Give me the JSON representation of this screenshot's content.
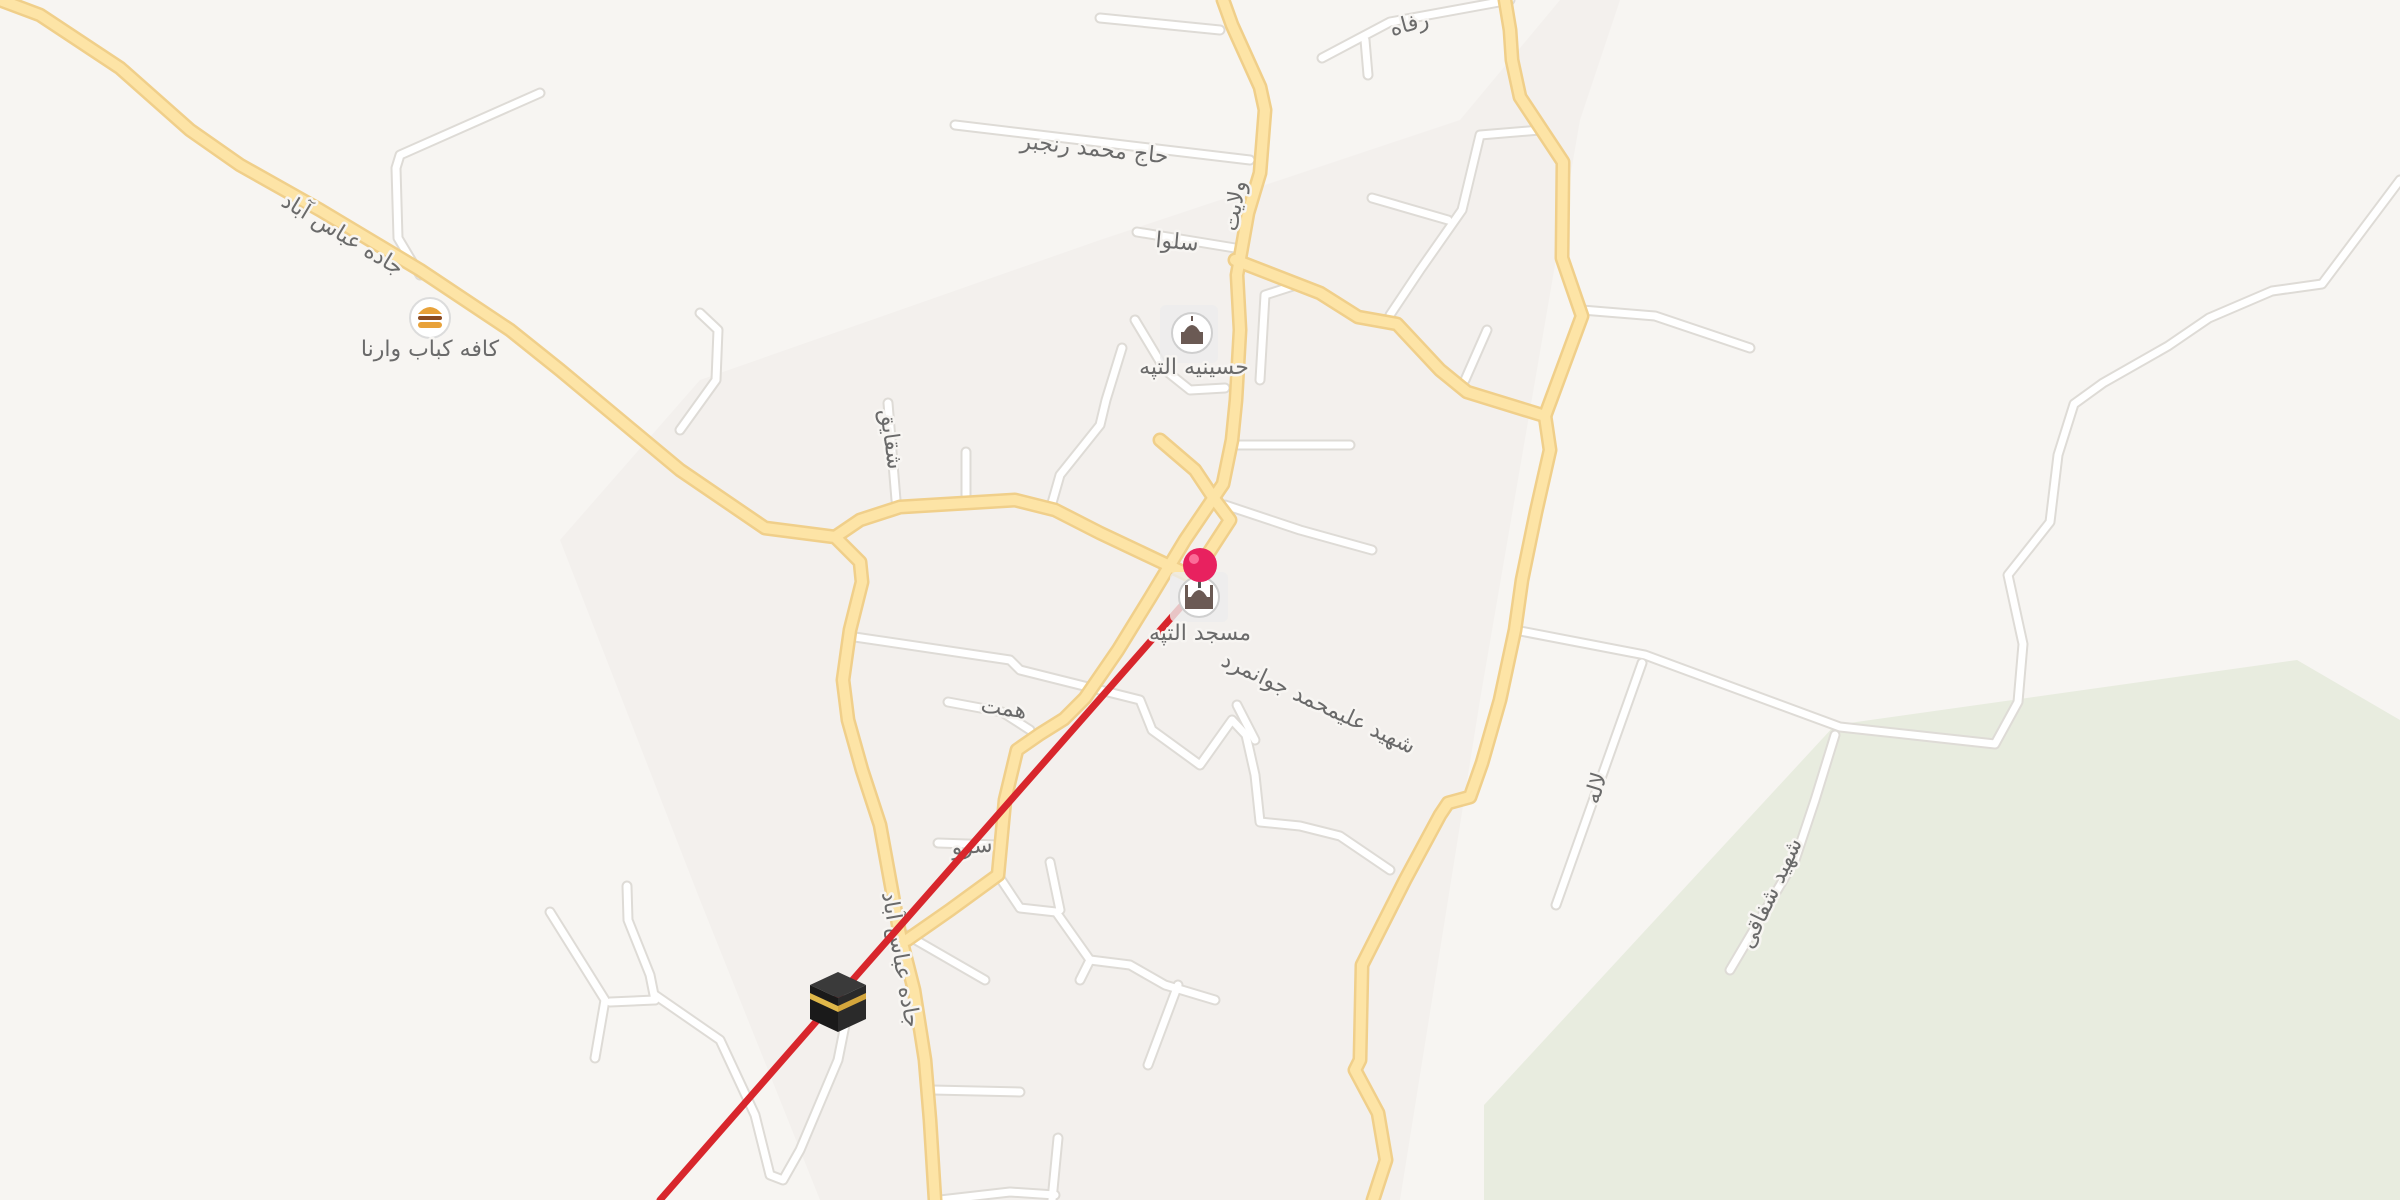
{
  "colors": {
    "land": "#f7f5f2",
    "park": "#e8ecdf",
    "main_road_fill": "#fde4a6",
    "main_road_casing": "#f0cf8a",
    "minor_road_fill": "#ffffff",
    "minor_road_casing": "#dedbd6",
    "route_line": "#d8262c",
    "pin": "#e8215f",
    "label": "#6a6a6a"
  },
  "roads": {
    "abbas_abad_upper": "جاده عباس آباد",
    "abbas_abad_lower": "جاده عباس آباد",
    "haj_mohammad": "حاج محمد رنجبر",
    "selva": "سلوا",
    "velayat": "ولایت",
    "refah": "رفاه",
    "shaghayegh": "شقایق",
    "hemmat": "همت",
    "sarv": "سرو",
    "shahid_javanmard": "شهید علیمحمد جوانمرد",
    "laleh": "لاله",
    "shahid_shafaghi": "شهید شفاقی"
  },
  "pois": {
    "cafe": {
      "label": "کافه کباب وارنا",
      "icon": "burger-icon"
    },
    "hosseinieh": {
      "label": "حسینیه التپه",
      "icon": "mosque-icon"
    },
    "mosque": {
      "label": "مسجد التپه",
      "icon": "mosque-icon"
    },
    "kaaba": {
      "icon": "kaaba-icon"
    },
    "pin": {
      "icon": "map-pin-icon"
    }
  }
}
